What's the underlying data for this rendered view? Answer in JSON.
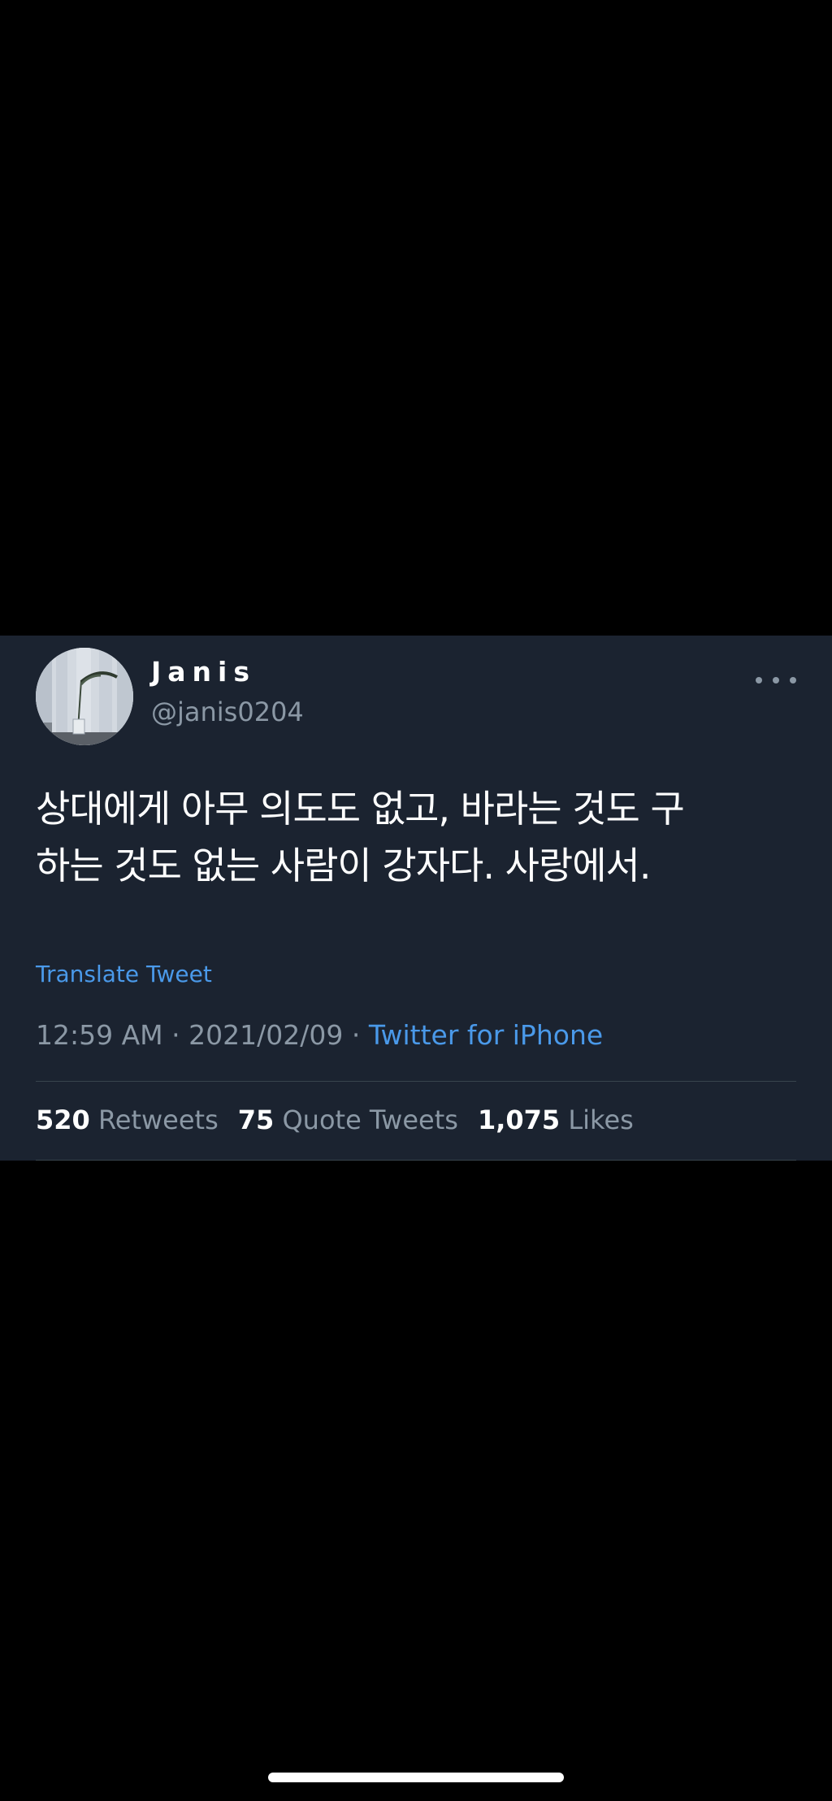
{
  "tweet": {
    "display_name": "Janis",
    "handle": "@janis0204",
    "more_icon": "more-horizontal-icon",
    "text_line_1": "상대에게 아무 의도도 없고, 바라는 것도 구",
    "text_line_2": "하는 것도 없는 사람이 강자다. 사랑에서.",
    "translate_label": "Translate Tweet",
    "time": "12:59 AM",
    "separator": " · ",
    "date": "2021/02/09",
    "client": "Twitter for iPhone",
    "stats": {
      "retweets_count": "520",
      "retweets_label": "Retweets",
      "quotes_count": "75",
      "quotes_label": "Quote Tweets",
      "likes_count": "1,075",
      "likes_label": "Likes"
    }
  },
  "colors": {
    "background": "#000000",
    "card": "#1b2330",
    "text_primary": "#ffffff",
    "text_secondary": "#8b98a5",
    "link": "#4a99e9",
    "divider": "#38444d"
  }
}
